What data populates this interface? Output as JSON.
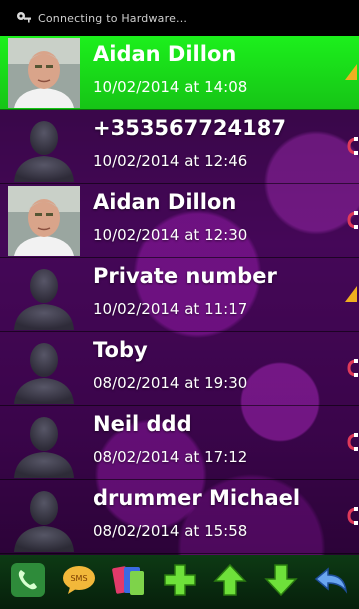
{
  "status_bar": {
    "text": "Connecting to Hardware..."
  },
  "calls": [
    {
      "name": "Aidan Dillon",
      "datetime": "10/02/2014 at 14:08",
      "avatar": "photo",
      "call_type": "missed",
      "selected": true
    },
    {
      "name": "+353567724187",
      "datetime": "10/02/2014 at 12:46",
      "avatar": "silhouette",
      "call_type": "incoming",
      "selected": false
    },
    {
      "name": "Aidan Dillon",
      "datetime": "10/02/2014 at 12:30",
      "avatar": "photo",
      "call_type": "incoming",
      "selected": false
    },
    {
      "name": "Private number",
      "datetime": "10/02/2014 at 11:17",
      "avatar": "silhouette",
      "call_type": "missed",
      "selected": false
    },
    {
      "name": "Toby",
      "datetime": "08/02/2014 at 19:30",
      "avatar": "silhouette",
      "call_type": "incoming",
      "selected": false
    },
    {
      "name": "Neil ddd",
      "datetime": "08/02/2014 at 17:12",
      "avatar": "silhouette",
      "call_type": "incoming",
      "selected": false
    },
    {
      "name": "drummer Michael",
      "datetime": "08/02/2014 at 15:58",
      "avatar": "silhouette",
      "call_type": "incoming",
      "selected": false
    }
  ],
  "toolbar": {
    "buttons": [
      "phone-icon",
      "sms-icon",
      "contacts-card-icon",
      "add-icon",
      "arrow-up-icon",
      "arrow-down-icon",
      "back-icon"
    ]
  },
  "colors": {
    "selected_row": "#1cf01c",
    "background": "#4a0c5c",
    "missed_indicator": "#f0b020",
    "incoming_indicator": "#e03a5a"
  }
}
